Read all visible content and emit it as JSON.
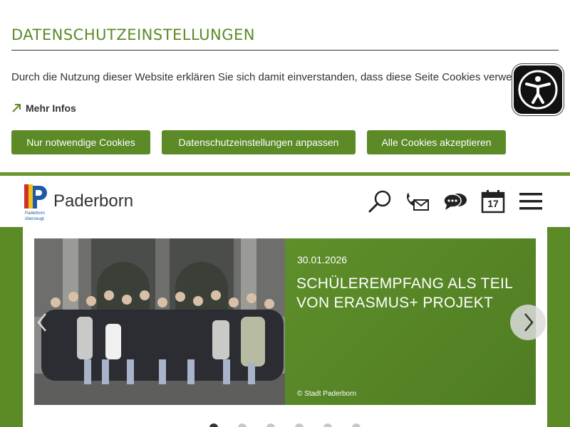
{
  "cookie_banner": {
    "title": "DATENSCHUTZEINSTELLUNGEN",
    "text": "Durch die Nutzung dieser Website erklären Sie sich damit einverstanden, dass diese Seite Cookies verwendet.",
    "more_info": "Mehr Infos",
    "buttons": {
      "necessary": "Nur notwendige Cookies",
      "customize": "Datenschutzeinstellungen anpassen",
      "accept_all": "Alle Cookies akzeptieren"
    }
  },
  "accessibility": {
    "icon": "accessibility-person-icon"
  },
  "header": {
    "brand": "Paderborn",
    "logo_text": "Paderborn überzeugt.",
    "icons": [
      "search-icon",
      "contact-phone-mail-icon",
      "chat-icon",
      "calendar-icon",
      "menu-icon"
    ],
    "calendar_day": "17"
  },
  "slider": {
    "date": "30.01.2026",
    "title": "SCHÜLEREMPFANG ALS TEIL VON ERASMUS+ PROJEKT",
    "credit": "© Stadt Paderborn",
    "slide_count": 6,
    "active_slide": 1
  },
  "colors": {
    "brand_green": "#5b8a26",
    "text_dark": "#333333"
  }
}
